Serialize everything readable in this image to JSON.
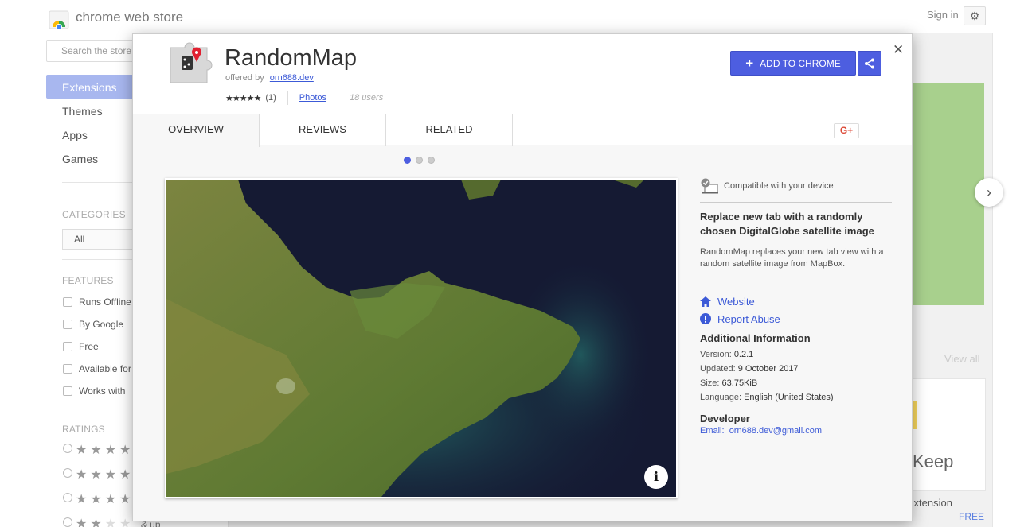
{
  "store": {
    "title": "chrome web store",
    "search_placeholder": "Search the store",
    "sign_in": "Sign in",
    "nav": [
      {
        "label": "Extensions"
      },
      {
        "label": "Themes"
      },
      {
        "label": "Apps"
      },
      {
        "label": "Games"
      }
    ],
    "categories_heading": "CATEGORIES",
    "category_value": "All",
    "features_heading": "FEATURES",
    "features": [
      "Runs Offline",
      "By Google",
      "Free",
      "Available for",
      "Works with"
    ],
    "ratings_heading": "RATINGS",
    "rating_up_label": "& up",
    "view_all": "View all",
    "keep_text": "Keep",
    "extension_text": "e Extension",
    "free_text": "FREE"
  },
  "extension": {
    "name": "RandomMap",
    "offered_by_label": "offered by",
    "developer_link": "orn688.dev",
    "rating_stars": "★★★★★",
    "rating_count": "(1)",
    "photos_link": "Photos",
    "users": "18 users",
    "add_button": "ADD TO CHROME"
  },
  "tabs": [
    {
      "label": "OVERVIEW"
    },
    {
      "label": "REVIEWS"
    },
    {
      "label": "RELATED"
    }
  ],
  "gplus_label": "G+",
  "carousel": {
    "total": 3,
    "active": 1
  },
  "details": {
    "compatible": "Compatible with your device",
    "summary": "Replace new tab with a randomly chosen DigitalGlobe satellite image",
    "description": "RandomMap replaces your new tab view with a random satellite image from MapBox.",
    "website": "Website",
    "report_abuse": "Report Abuse",
    "additional_title": "Additional Information",
    "version_label": "Version:",
    "version": "0.2.1",
    "updated_label": "Updated:",
    "updated": "9 October 2017",
    "size_label": "Size:",
    "size": "63.75KiB",
    "language_label": "Language:",
    "language": "English (United States)",
    "developer_title": "Developer",
    "email_label": "Email:",
    "email": "orn688.dev@gmail.com"
  },
  "colors": {
    "accent": "#4d5ee0",
    "link": "#3c5ad7",
    "sea": "#151a33",
    "land": "#6f7a3a"
  },
  "icons": {
    "logo": "chrome-logo-icon",
    "settings": "gear-icon",
    "share": "share-icon",
    "close": "close-icon",
    "home": "home-icon",
    "abuse": "exclamation-icon",
    "compat": "device-check-icon",
    "info": "info-icon",
    "next": "chevron-right-icon"
  }
}
